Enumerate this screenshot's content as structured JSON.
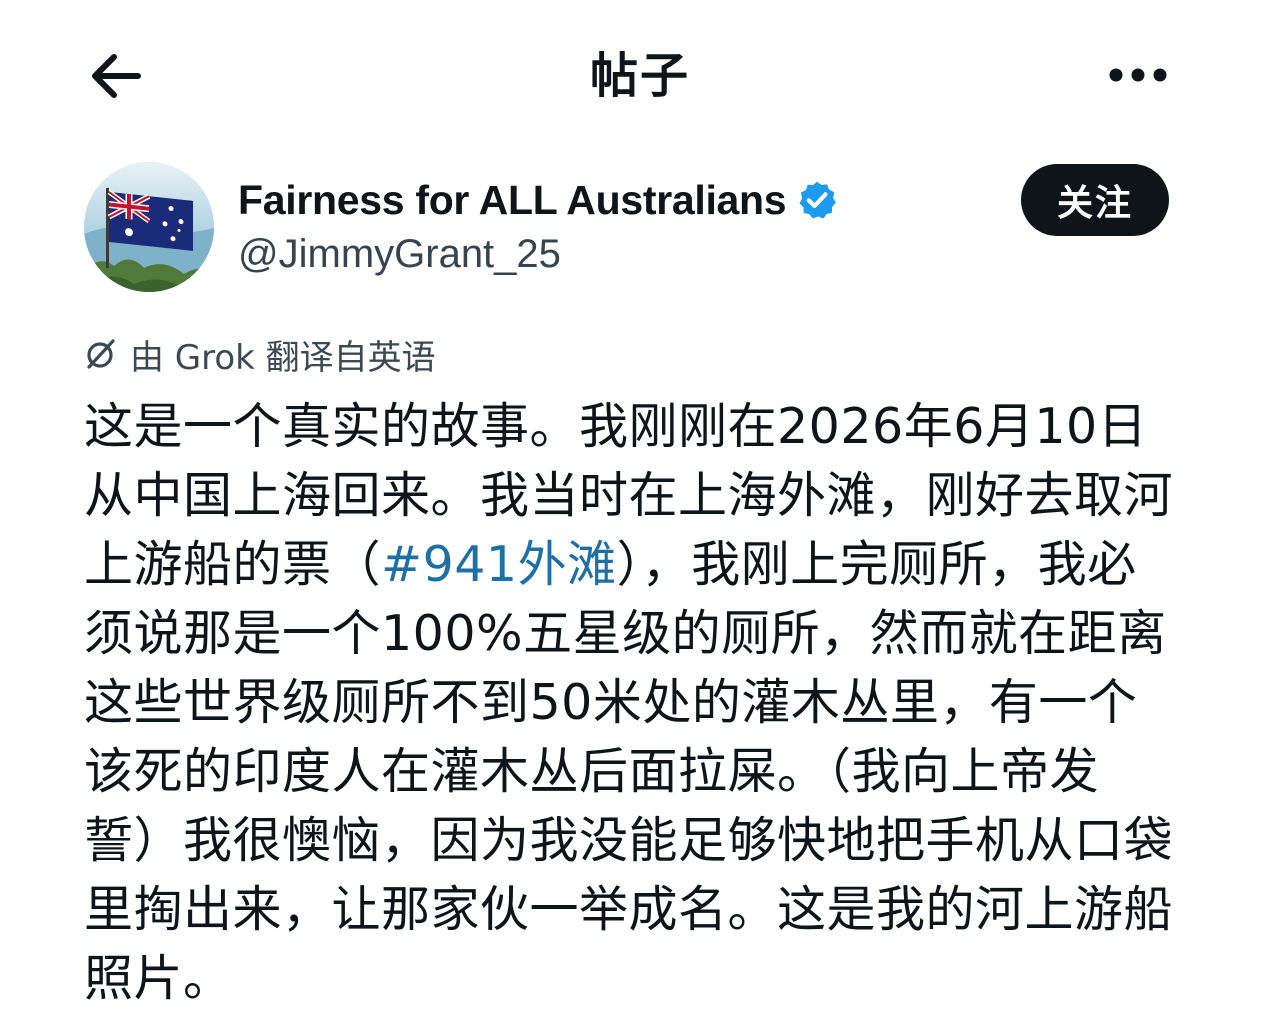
{
  "header": {
    "title": "帖子",
    "back_icon": "arrow-left-icon",
    "more_icon": "more-horizontal-icon"
  },
  "author": {
    "name": "Fairness for ALL Australians",
    "handle": "@JimmyGrant_25",
    "verified": true,
    "verified_color": "#1d9bf0",
    "avatar_icon": "australian-flag-avatar"
  },
  "follow_button": {
    "label": "关注"
  },
  "translation": {
    "icon": "grok-icon",
    "label": "由 Grok 翻译自英语"
  },
  "post": {
    "lines": [
      {
        "text": "这是一个真实的故事。我刚刚在2026年6月10日"
      },
      {
        "text": "从中国上海回来。我当时在上海外滩，刚好去取河"
      },
      {
        "before": "上游船的票（",
        "hashtag": "#941外滩",
        "after": "），我刚上完厕所，我必"
      },
      {
        "text": "须说那是一个100%五星级的厕所，然而就在距离"
      },
      {
        "text": "这些世界级厕所不到50米处的灌木丛里，有一个"
      },
      {
        "text": "该死的印度人在灌木丛后面拉屎。（我向上帝发"
      },
      {
        "text": "誓）我很懊恼，因为我没能足够快地把手机从口袋"
      },
      {
        "text": "里掏出来，让那家伙一举成名。这是我的河上游船"
      },
      {
        "text": "照片。"
      }
    ],
    "hashtag_color": "#1d6fa5"
  }
}
